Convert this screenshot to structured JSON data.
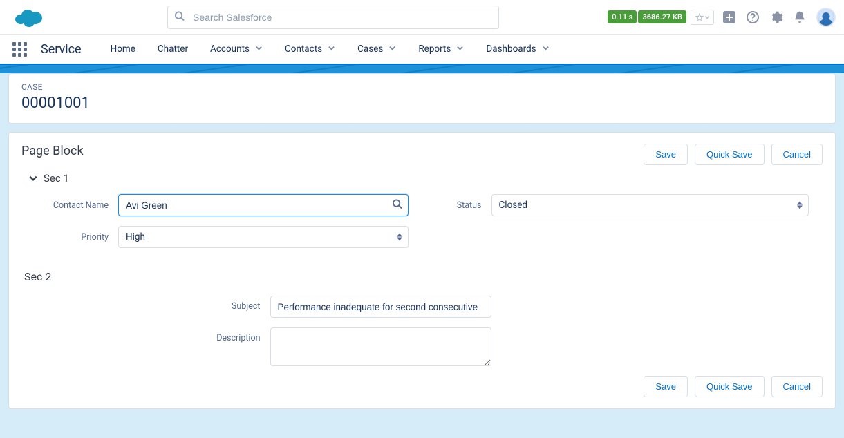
{
  "header": {
    "search_placeholder": "Search Salesforce",
    "badge_time": "0.11 s",
    "badge_size": "3686.27 KB"
  },
  "nav": {
    "app_name": "Service",
    "tabs": [
      {
        "label": "Home",
        "has_menu": false
      },
      {
        "label": "Chatter",
        "has_menu": false
      },
      {
        "label": "Accounts",
        "has_menu": true
      },
      {
        "label": "Contacts",
        "has_menu": true
      },
      {
        "label": "Cases",
        "has_menu": true
      },
      {
        "label": "Reports",
        "has_menu": true
      },
      {
        "label": "Dashboards",
        "has_menu": true
      }
    ]
  },
  "record": {
    "object_label": "CASE",
    "number": "00001001"
  },
  "page_block": {
    "title": "Page Block",
    "buttons": {
      "save": "Save",
      "quick_save": "Quick Save",
      "cancel": "Cancel"
    },
    "sec1": {
      "title": "Sec 1",
      "contact_label": "Contact Name",
      "contact_value": "Avi Green",
      "priority_label": "Priority",
      "priority_value": "High",
      "status_label": "Status",
      "status_value": "Closed"
    },
    "sec2": {
      "title": "Sec 2",
      "subject_label": "Subject",
      "subject_value": "Performance inadequate for second consecutive",
      "description_label": "Description",
      "description_value": ""
    }
  }
}
